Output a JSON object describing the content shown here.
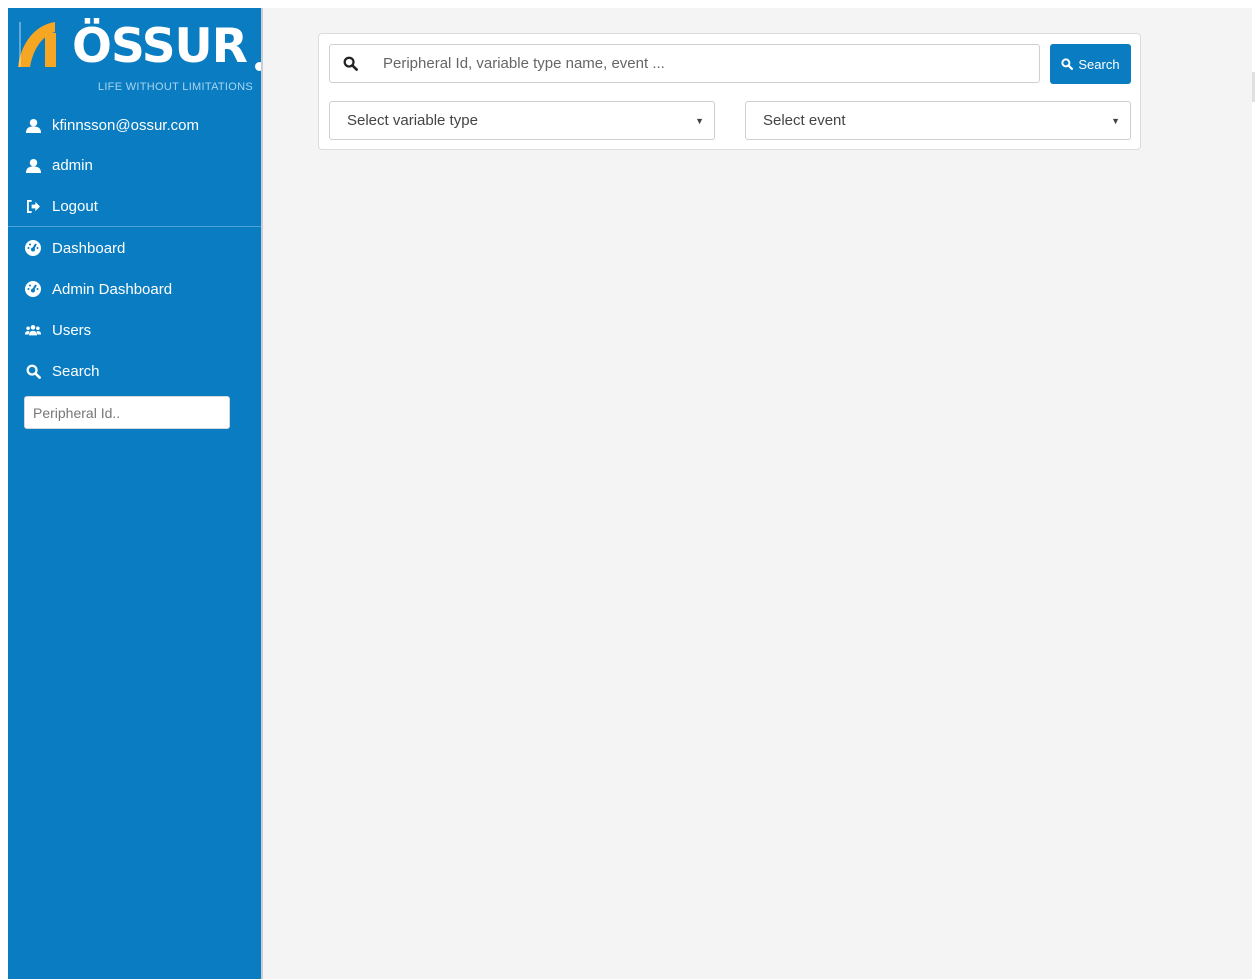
{
  "brand": {
    "name": "ÖSSUR",
    "tagline": "LIFE WITHOUT LIMITATIONS",
    "primary_color": "#0a7dc2",
    "accent_color": "#f5a623"
  },
  "sidebar": {
    "user_items": [
      {
        "label": "kfinnsson@ossur.com",
        "icon": "user-icon"
      },
      {
        "label": "admin",
        "icon": "user-icon"
      },
      {
        "label": "Logout",
        "icon": "sign-out-icon"
      }
    ],
    "nav_items": [
      {
        "label": "Dashboard",
        "icon": "dashboard-icon"
      },
      {
        "label": "Admin Dashboard",
        "icon": "dashboard-icon"
      },
      {
        "label": "Users",
        "icon": "users-icon"
      },
      {
        "label": "Search",
        "icon": "search-icon"
      }
    ],
    "search_placeholder": "Peripheral Id.."
  },
  "main": {
    "search": {
      "placeholder": "Peripheral Id, variable type name, event ...",
      "button_label": "Search"
    },
    "filters": {
      "variable_type": {
        "selected": "Select variable type"
      },
      "event": {
        "selected": "Select event"
      }
    }
  }
}
